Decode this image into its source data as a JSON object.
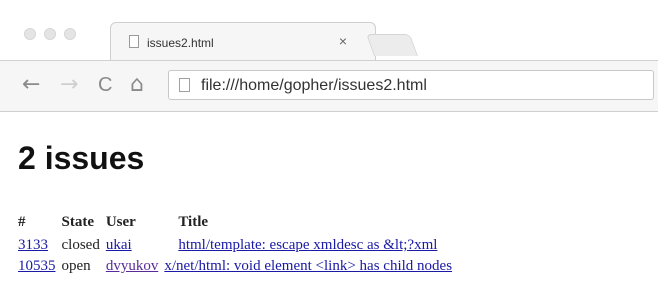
{
  "browser": {
    "tab_title": "issues2.html",
    "tab_close": "×",
    "url": "file:///home/gopher/issues2.html",
    "nav": {
      "back": "←",
      "forward": "→",
      "reload": "C",
      "home": "⌂"
    }
  },
  "page": {
    "heading": "2 issues",
    "columns": [
      "#",
      "State",
      "User",
      "Title"
    ],
    "rows": [
      {
        "number": "3133",
        "state": "closed",
        "user": "ukai",
        "title": "html/template: escape xmldesc as &lt;?xml"
      },
      {
        "number": "10535",
        "state": "open",
        "user": "dvyukov",
        "title": "x/net/html: void element <link> has child nodes"
      }
    ]
  },
  "colors": {
    "link": "#1a1aa6",
    "visited_link": "#5a2a9a"
  }
}
